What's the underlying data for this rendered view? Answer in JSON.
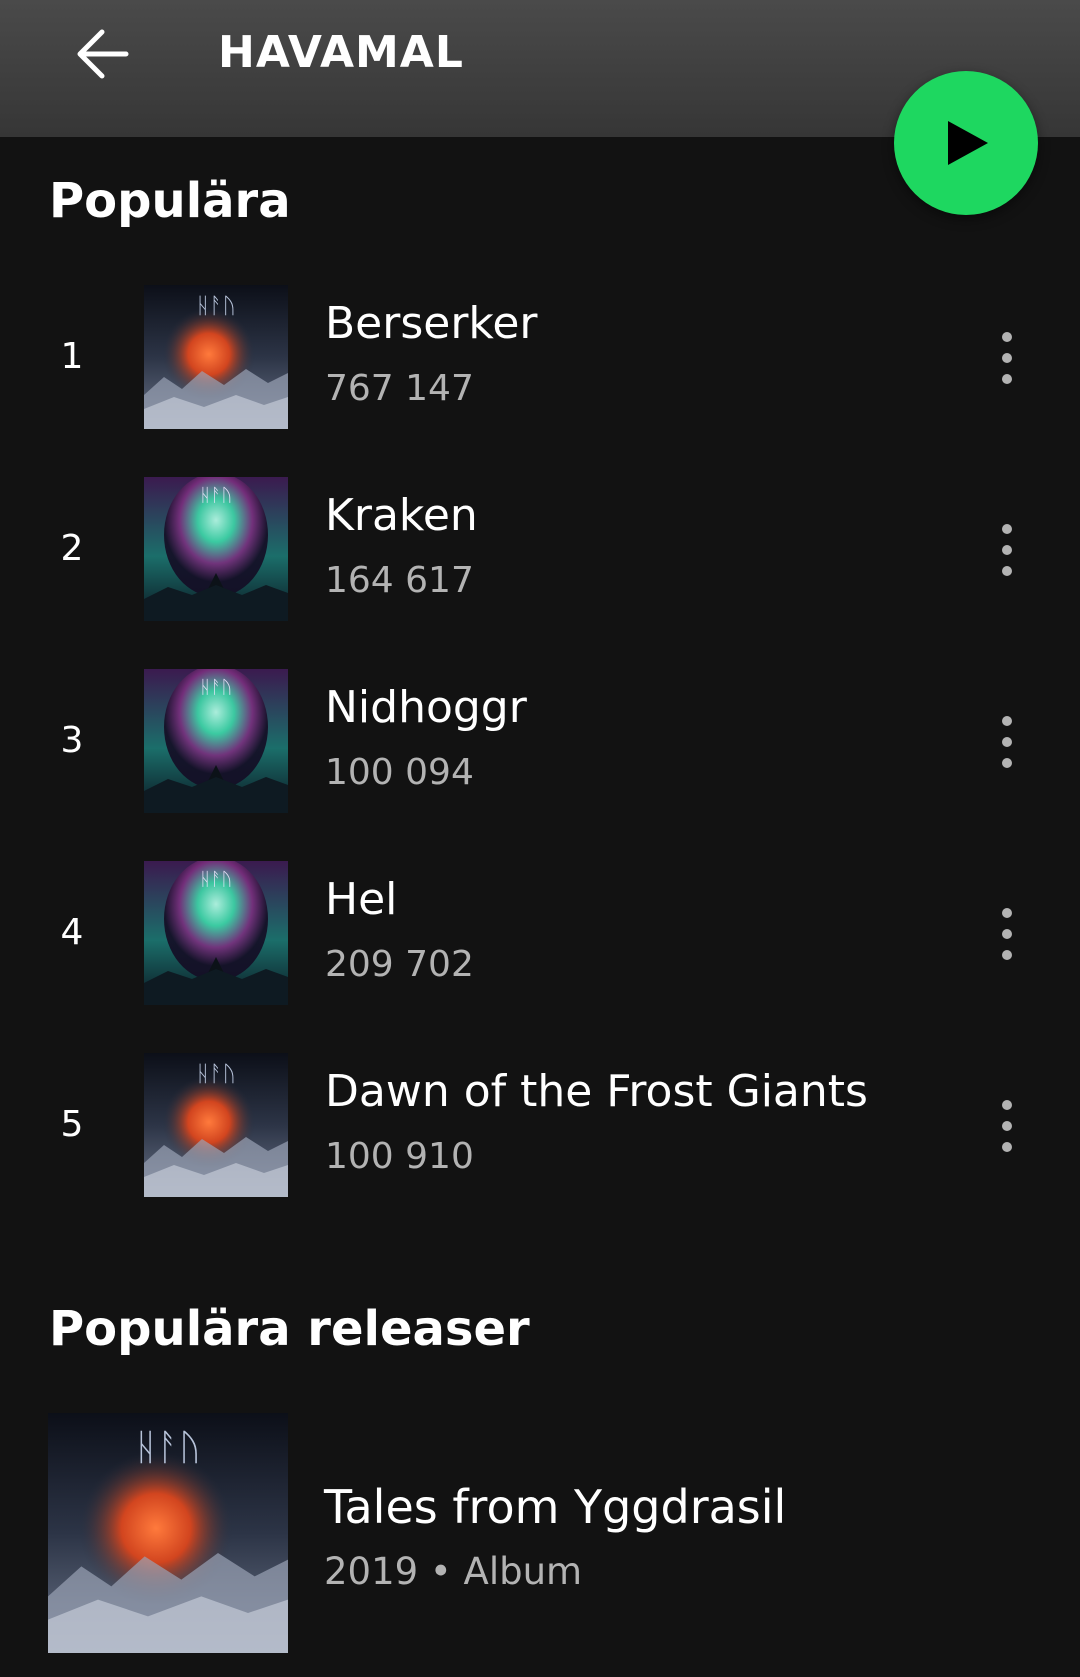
{
  "header": {
    "title": "HAVAMAL",
    "back_icon": "arrow-left-icon",
    "play_icon": "play-icon",
    "play_color": "#1ed760"
  },
  "popular": {
    "heading": "Populära",
    "tracks": [
      {
        "rank": "1",
        "title": "Berserker",
        "plays": "767 147",
        "cover": "tales-from-yggdrasil-cover"
      },
      {
        "rank": "2",
        "title": "Kraken",
        "plays": "164 617",
        "cover": "aurora-wolf-cover"
      },
      {
        "rank": "3",
        "title": "Nidhoggr",
        "plays": "100 094",
        "cover": "aurora-wolf-cover"
      },
      {
        "rank": "4",
        "title": "Hel",
        "plays": "209 702",
        "cover": "aurora-wolf-cover"
      },
      {
        "rank": "5",
        "title": "Dawn of the Frost Giants",
        "plays": "100 910",
        "cover": "tales-from-yggdrasil-cover"
      }
    ]
  },
  "popular_releases": {
    "heading": "Populära releaser",
    "items": [
      {
        "title": "Tales from Yggdrasil",
        "meta": "2019 • Album",
        "cover": "tales-from-yggdrasil-cover"
      }
    ]
  },
  "colors": {
    "background": "#121212",
    "header_bg": "#404040",
    "secondary_text": "#b3b3b3",
    "accent": "#1ed760"
  }
}
